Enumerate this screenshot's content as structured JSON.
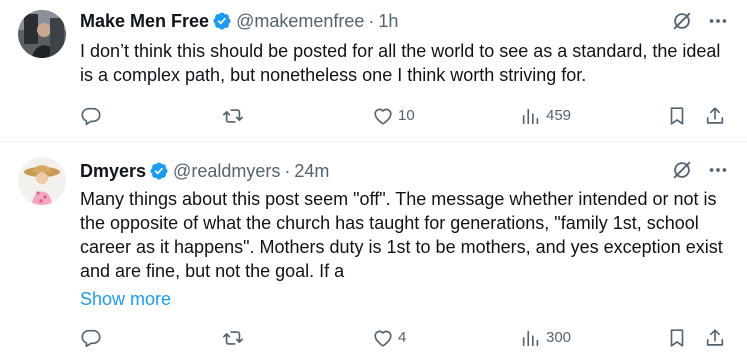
{
  "tweets": [
    {
      "display_name": "Make Men Free",
      "handle": "@makemenfree",
      "separator": "·",
      "time": "1h",
      "text": "I don’t think this should be posted for all the world to see as a standard, the ideal is a complex path, but nonetheless one I think worth striving for.",
      "show_more": "",
      "stats": {
        "replies": "",
        "reposts": "",
        "likes": "10",
        "views": "459"
      }
    },
    {
      "display_name": "Dmyers",
      "handle": "@realdmyers",
      "separator": "·",
      "time": "24m",
      "text": "Many things about this post seem \"off\". The message whether intended or not is the opposite of what the church has taught for generations, \"family 1st, school career as it happens\".  Mothers duty is 1st to be mothers, and yes exception exist and are fine, but not the goal.  If a",
      "show_more": "Show more",
      "stats": {
        "replies": "",
        "reposts": "",
        "likes": "4",
        "views": "300"
      }
    }
  ],
  "icons": {
    "verified": "verified-badge-icon",
    "grok": "grok-icon",
    "more": "more-icon",
    "reply": "reply-icon",
    "repost": "repost-icon",
    "like": "heart-icon",
    "views": "views-icon",
    "bookmark": "bookmark-icon",
    "share": "share-icon"
  },
  "colors": {
    "text": "#0f1419",
    "secondary": "#536471",
    "verified": "#1d9bf0",
    "link": "#1d9bf0",
    "divider": "#eff3f4"
  }
}
